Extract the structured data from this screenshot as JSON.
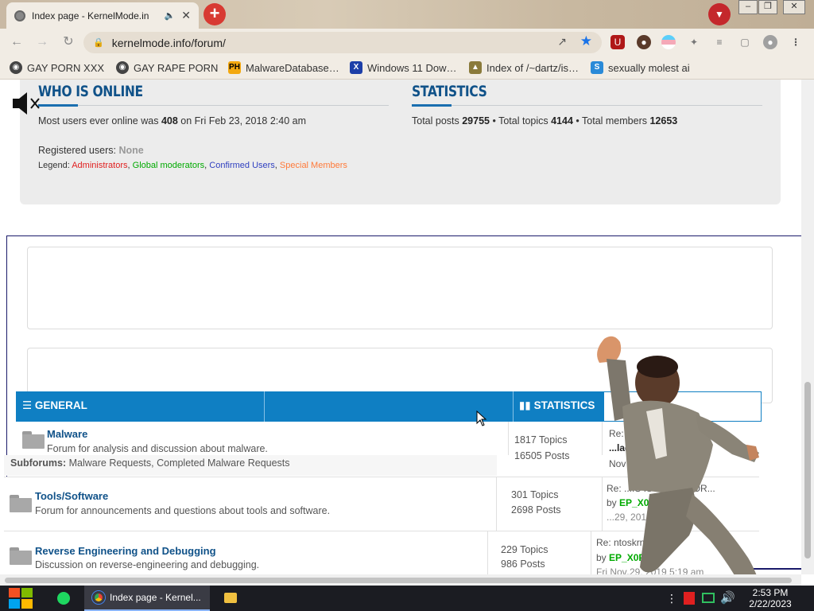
{
  "browser": {
    "tab_title": "Index page - KernelMode.in",
    "url": "kernelmode.info/forum/",
    "bookmarks": [
      {
        "label": "GAY PORN XXX",
        "icon": "globe-icon"
      },
      {
        "label": "GAY RAPE PORN",
        "icon": "globe-icon"
      },
      {
        "label": "MalwareDatabase…",
        "icon": "ph-icon"
      },
      {
        "label": "Windows 11 Dow…",
        "icon": "x-icon"
      },
      {
        "label": "Index of /~dartz/is…",
        "icon": "folder-icon"
      },
      {
        "label": "sexually molest ai",
        "icon": "app-icon"
      }
    ]
  },
  "who_is_online": {
    "title": "WHO IS ONLINE",
    "most_users_pre": "Most users ever online was ",
    "most_users_count": "408",
    "most_users_post": " on Fri Feb 23, 2018 2:40 am",
    "registered_label": "Registered users: ",
    "registered_value": "None",
    "legend_label": "Legend: ",
    "legend": [
      {
        "label": "Administrators",
        "color": "#e02020"
      },
      {
        "label": "Global moderators",
        "color": "#00aa00"
      },
      {
        "label": "Confirmed Users",
        "color": "#3040c0"
      },
      {
        "label": "Special Members",
        "color": "#ff7a3a"
      }
    ]
  },
  "statistics": {
    "title": "STATISTICS",
    "posts_label": "Total posts ",
    "posts": "29755",
    "topics_label": " • Total topics ",
    "topics": "4144",
    "members_label": " • Total members ",
    "members": "12653"
  },
  "forum_table": {
    "general_label": "GENERAL",
    "statistics_label": "STATISTICS",
    "forums": [
      {
        "name": "Malware",
        "description": "Forum for analysis and discussion about malware.",
        "topics": "1817 Topics",
        "posts": "16505 Posts",
        "subforums_label": "Subforums:",
        "subforums": "Malware Requests, Completed Malware Requests",
        "last_title": "Re: ...ation",
        "last_by": "...laddog...",
        "last_date": "Nov 25, 2...5 pm"
      },
      {
        "name": "Tools/Software",
        "description": "Forum for announcements and questions about tools and software.",
        "topics": "301 Topics",
        "posts": "2698 Posts",
        "last_title": "Re: ...IS IS CHILD POR...",
        "last_by_prefix": "by ",
        "last_by": "EP_X0FF",
        "last_date": "...29, 2019 5:17 am"
      },
      {
        "name": "Reverse Engineering and Debugging",
        "description": "Discussion on reverse-engineering and debugging.",
        "topics": "229 Topics",
        "posts": "986 Posts",
        "last_title": "Re: ntoskrnl.exe",
        "last_by_prefix": "by ",
        "last_by": "EP_X0FF",
        "last_date": "Fri Nov 29, 2019 5:19 am"
      }
    ]
  },
  "taskbar": {
    "app_label": "Index page - Kernel...",
    "time": "2:53 PM",
    "date": "2/22/2023"
  }
}
